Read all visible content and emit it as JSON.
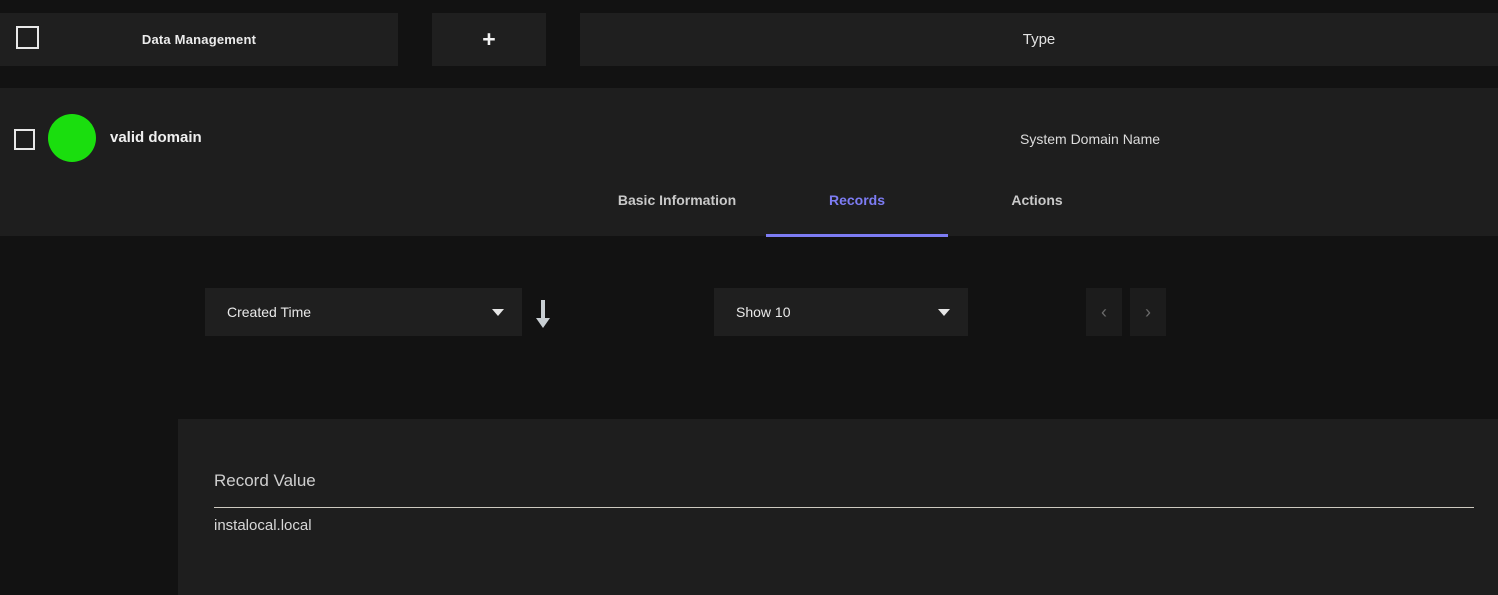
{
  "topbar": {
    "checkbox_name": "select-all-checkbox",
    "cards": [
      {
        "label": "Data Management",
        "name": "data-management-card"
      },
      {
        "label": "+",
        "name": "add-card"
      },
      {
        "label": "Type",
        "name": "type-column-card"
      }
    ]
  },
  "domain_header": {
    "status_color": "#1ade0e",
    "name": "valid domain",
    "type": "System Domain Name"
  },
  "tabs": [
    {
      "label": "Basic Information",
      "active": false
    },
    {
      "label": "Records",
      "active": true
    },
    {
      "label": "Actions",
      "active": false
    }
  ],
  "accent_color": "#7d7cf3",
  "controls": {
    "sort_by": {
      "value": "Created Time"
    },
    "sort_direction": "descending",
    "page_size": {
      "value": "Show 10"
    },
    "pager": {
      "prev": "‹",
      "next": "›"
    }
  },
  "records_table": {
    "columns": [
      "Record Value"
    ],
    "rows": [
      {
        "record_value": "instalocal.local"
      }
    ]
  }
}
